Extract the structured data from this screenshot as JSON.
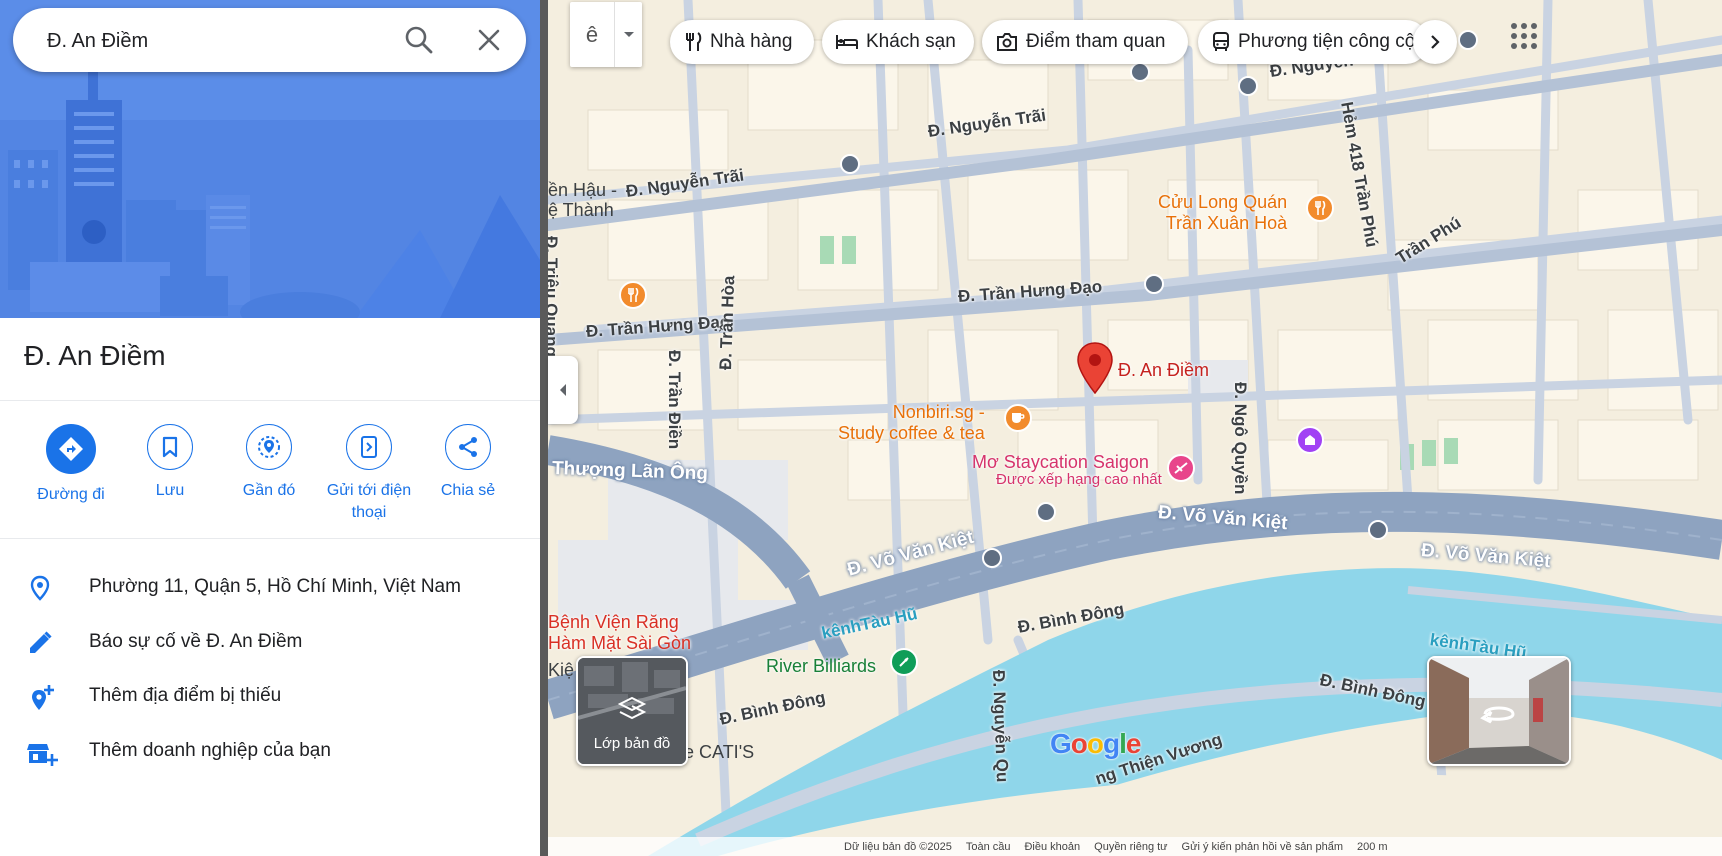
{
  "search": {
    "value": "Đ. An Điềm",
    "icon_search": "search-icon",
    "icon_clear": "close-icon"
  },
  "place": {
    "title": "Đ. An Điềm"
  },
  "actions": [
    {
      "label": "Đường đi",
      "icon": "directions-icon"
    },
    {
      "label": "Lưu",
      "icon": "bookmark-icon"
    },
    {
      "label": "Gần đó",
      "icon": "nearby-icon"
    },
    {
      "label": "Gửi tới điện thoại",
      "icon": "send-to-phone-icon"
    },
    {
      "label": "Chia sẻ",
      "icon": "share-icon"
    }
  ],
  "info": {
    "address": "Phường 11, Quận 5, Hồ Chí Minh, Việt Nam",
    "report": "Báo sự cố về Đ. An Điềm",
    "add_place": "Thêm địa điểm bị thiếu",
    "add_business": "Thêm doanh nghiệp của bạn"
  },
  "map": {
    "toggle_label": "ê",
    "chips": [
      "Nhà hàng",
      "Khách sạn",
      "Điểm tham quan",
      "Phương tiện công cộng"
    ],
    "layers_label": "Lớp bản đồ",
    "logo": "Google",
    "streets": {
      "nguyen_trai_1": "Đ. Nguyễn Trãi",
      "nguyen_trai_2": "Đ. Nguyễn Trãi",
      "nguyen_top": "Đ. Nguyễn",
      "tran_hung_dao_1": "Đ. Trần Hưng Đạo",
      "tran_hung_dao_2": "Đ. Trần Hưng Đạo",
      "vo_van_kiet_1": "Đ. Võ Văn Kiệt",
      "vo_van_kiet_2": "Đ. Võ Văn Kiệt",
      "vo_van_kiet_3": "Đ. Võ Văn Kiệt",
      "thuong_lan_ong": "Thượng Lãn Ông",
      "binh_dong_1": "Đ. Bình Đông",
      "binh_dong_2": "Đ. Bình Đông",
      "binh_dong_3": "Đ. Bình Đông",
      "tran_dien": "Đ. Trần Điền",
      "tran_hoa": "Đ. Trần Hòa",
      "trieu_quang": "Đ. Triệu Quang",
      "ngo_quyen": "Đ. Ngô Quyền",
      "hem_418": "Hẻm 418 Trần Phú",
      "tran_phu": "Trần Phú",
      "nguyen_q": "Đ. Nguyễn Qu",
      "thien_vuong": "ng Thiện Vương",
      "kenh_tau_hu_1": "kênhTàu Hũ",
      "kenh_tau_hu_2": "kênhTàu Hũ",
      "en_hau": "ền Hậu -",
      "e_thanh": "ệ Thành",
      "kit": "Kiệ",
      "cati": "ee CATI'S"
    },
    "pois": {
      "selected": "Đ. An Điềm",
      "cuu_long": "Cửu Long Quán\nTrần Xuân Hoà",
      "nonbiri": "Nonbiri.sg -\nStudy coffee & tea",
      "mo_staycation": "Mơ Staycation Saigon",
      "mo_sub": "Được xếp hạng cao nhất",
      "benh_vien": "Bệnh Viện Răng\nHàm Mặt Sài Gòn",
      "river_billiards": "River Billiards"
    },
    "attribution": [
      "Dữ liệu bản đồ ©2025",
      "Toàn cầu",
      "Điều khoản",
      "Quyền riêng tư",
      "Gửi ý kiến phản hồi về sản phẩm",
      "200 m"
    ],
    "colors": {
      "water": "#8fd6ea",
      "major_road": "#8ea3c0",
      "accent": "#1a73e8",
      "pin": "#ea4335"
    }
  }
}
